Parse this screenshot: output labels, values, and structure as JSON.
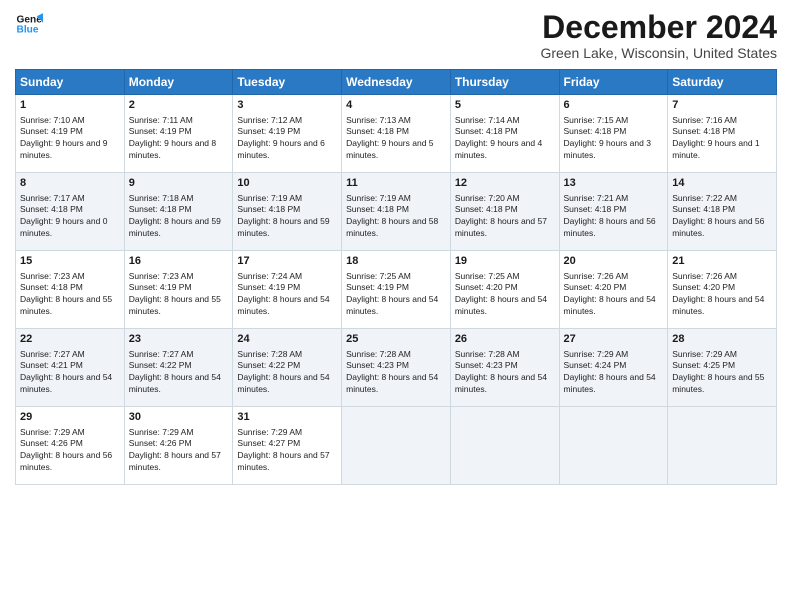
{
  "logo": {
    "line1": "General",
    "line2": "Blue"
  },
  "title": "December 2024",
  "location": "Green Lake, Wisconsin, United States",
  "days_of_week": [
    "Sunday",
    "Monday",
    "Tuesday",
    "Wednesday",
    "Thursday",
    "Friday",
    "Saturday"
  ],
  "weeks": [
    [
      {
        "day": 1,
        "sunrise": "Sunrise: 7:10 AM",
        "sunset": "Sunset: 4:19 PM",
        "daylight": "Daylight: 9 hours and 9 minutes."
      },
      {
        "day": 2,
        "sunrise": "Sunrise: 7:11 AM",
        "sunset": "Sunset: 4:19 PM",
        "daylight": "Daylight: 9 hours and 8 minutes."
      },
      {
        "day": 3,
        "sunrise": "Sunrise: 7:12 AM",
        "sunset": "Sunset: 4:19 PM",
        "daylight": "Daylight: 9 hours and 6 minutes."
      },
      {
        "day": 4,
        "sunrise": "Sunrise: 7:13 AM",
        "sunset": "Sunset: 4:18 PM",
        "daylight": "Daylight: 9 hours and 5 minutes."
      },
      {
        "day": 5,
        "sunrise": "Sunrise: 7:14 AM",
        "sunset": "Sunset: 4:18 PM",
        "daylight": "Daylight: 9 hours and 4 minutes."
      },
      {
        "day": 6,
        "sunrise": "Sunrise: 7:15 AM",
        "sunset": "Sunset: 4:18 PM",
        "daylight": "Daylight: 9 hours and 3 minutes."
      },
      {
        "day": 7,
        "sunrise": "Sunrise: 7:16 AM",
        "sunset": "Sunset: 4:18 PM",
        "daylight": "Daylight: 9 hours and 1 minute."
      }
    ],
    [
      {
        "day": 8,
        "sunrise": "Sunrise: 7:17 AM",
        "sunset": "Sunset: 4:18 PM",
        "daylight": "Daylight: 9 hours and 0 minutes."
      },
      {
        "day": 9,
        "sunrise": "Sunrise: 7:18 AM",
        "sunset": "Sunset: 4:18 PM",
        "daylight": "Daylight: 8 hours and 59 minutes."
      },
      {
        "day": 10,
        "sunrise": "Sunrise: 7:19 AM",
        "sunset": "Sunset: 4:18 PM",
        "daylight": "Daylight: 8 hours and 59 minutes."
      },
      {
        "day": 11,
        "sunrise": "Sunrise: 7:19 AM",
        "sunset": "Sunset: 4:18 PM",
        "daylight": "Daylight: 8 hours and 58 minutes."
      },
      {
        "day": 12,
        "sunrise": "Sunrise: 7:20 AM",
        "sunset": "Sunset: 4:18 PM",
        "daylight": "Daylight: 8 hours and 57 minutes."
      },
      {
        "day": 13,
        "sunrise": "Sunrise: 7:21 AM",
        "sunset": "Sunset: 4:18 PM",
        "daylight": "Daylight: 8 hours and 56 minutes."
      },
      {
        "day": 14,
        "sunrise": "Sunrise: 7:22 AM",
        "sunset": "Sunset: 4:18 PM",
        "daylight": "Daylight: 8 hours and 56 minutes."
      }
    ],
    [
      {
        "day": 15,
        "sunrise": "Sunrise: 7:23 AM",
        "sunset": "Sunset: 4:18 PM",
        "daylight": "Daylight: 8 hours and 55 minutes."
      },
      {
        "day": 16,
        "sunrise": "Sunrise: 7:23 AM",
        "sunset": "Sunset: 4:19 PM",
        "daylight": "Daylight: 8 hours and 55 minutes."
      },
      {
        "day": 17,
        "sunrise": "Sunrise: 7:24 AM",
        "sunset": "Sunset: 4:19 PM",
        "daylight": "Daylight: 8 hours and 54 minutes."
      },
      {
        "day": 18,
        "sunrise": "Sunrise: 7:25 AM",
        "sunset": "Sunset: 4:19 PM",
        "daylight": "Daylight: 8 hours and 54 minutes."
      },
      {
        "day": 19,
        "sunrise": "Sunrise: 7:25 AM",
        "sunset": "Sunset: 4:20 PM",
        "daylight": "Daylight: 8 hours and 54 minutes."
      },
      {
        "day": 20,
        "sunrise": "Sunrise: 7:26 AM",
        "sunset": "Sunset: 4:20 PM",
        "daylight": "Daylight: 8 hours and 54 minutes."
      },
      {
        "day": 21,
        "sunrise": "Sunrise: 7:26 AM",
        "sunset": "Sunset: 4:20 PM",
        "daylight": "Daylight: 8 hours and 54 minutes."
      }
    ],
    [
      {
        "day": 22,
        "sunrise": "Sunrise: 7:27 AM",
        "sunset": "Sunset: 4:21 PM",
        "daylight": "Daylight: 8 hours and 54 minutes."
      },
      {
        "day": 23,
        "sunrise": "Sunrise: 7:27 AM",
        "sunset": "Sunset: 4:22 PM",
        "daylight": "Daylight: 8 hours and 54 minutes."
      },
      {
        "day": 24,
        "sunrise": "Sunrise: 7:28 AM",
        "sunset": "Sunset: 4:22 PM",
        "daylight": "Daylight: 8 hours and 54 minutes."
      },
      {
        "day": 25,
        "sunrise": "Sunrise: 7:28 AM",
        "sunset": "Sunset: 4:23 PM",
        "daylight": "Daylight: 8 hours and 54 minutes."
      },
      {
        "day": 26,
        "sunrise": "Sunrise: 7:28 AM",
        "sunset": "Sunset: 4:23 PM",
        "daylight": "Daylight: 8 hours and 54 minutes."
      },
      {
        "day": 27,
        "sunrise": "Sunrise: 7:29 AM",
        "sunset": "Sunset: 4:24 PM",
        "daylight": "Daylight: 8 hours and 54 minutes."
      },
      {
        "day": 28,
        "sunrise": "Sunrise: 7:29 AM",
        "sunset": "Sunset: 4:25 PM",
        "daylight": "Daylight: 8 hours and 55 minutes."
      }
    ],
    [
      {
        "day": 29,
        "sunrise": "Sunrise: 7:29 AM",
        "sunset": "Sunset: 4:26 PM",
        "daylight": "Daylight: 8 hours and 56 minutes."
      },
      {
        "day": 30,
        "sunrise": "Sunrise: 7:29 AM",
        "sunset": "Sunset: 4:26 PM",
        "daylight": "Daylight: 8 hours and 57 minutes."
      },
      {
        "day": 31,
        "sunrise": "Sunrise: 7:29 AM",
        "sunset": "Sunset: 4:27 PM",
        "daylight": "Daylight: 8 hours and 57 minutes."
      },
      null,
      null,
      null,
      null
    ]
  ]
}
